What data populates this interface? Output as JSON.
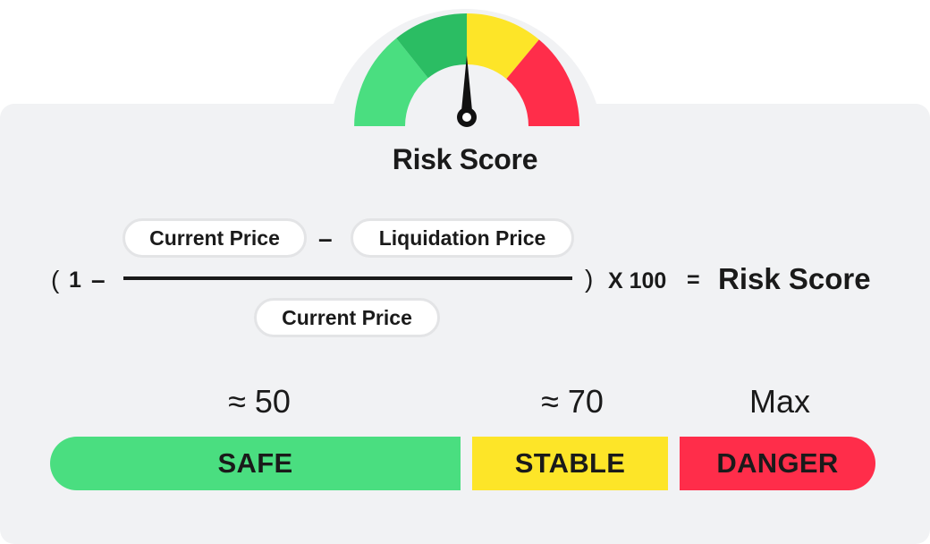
{
  "gauge": {
    "title": "Risk Score",
    "icon": "gauge-icon",
    "colors": {
      "light_green": "#4ade80",
      "dark_green": "#2bbd63",
      "yellow": "#fde528",
      "red": "#ff2d4a"
    }
  },
  "formula": {
    "open_paren": "(",
    "one": "1",
    "minus": "–",
    "numerator_left": "Current Price",
    "numerator_minus": "–",
    "numerator_right": "Liquidation Price",
    "denominator": "Current Price",
    "close_paren": ")",
    "multiplier": "X 100",
    "equals": "=",
    "result": "Risk Score"
  },
  "scale": {
    "thresholds": [
      {
        "label": "≈ 50"
      },
      {
        "label": "≈ 70"
      },
      {
        "label": "Max"
      }
    ],
    "segments": [
      {
        "label": "SAFE",
        "color": "#4ade80"
      },
      {
        "label": "STABLE",
        "color": "#fde528"
      },
      {
        "label": "DANGER",
        "color": "#ff2d4a"
      }
    ]
  }
}
